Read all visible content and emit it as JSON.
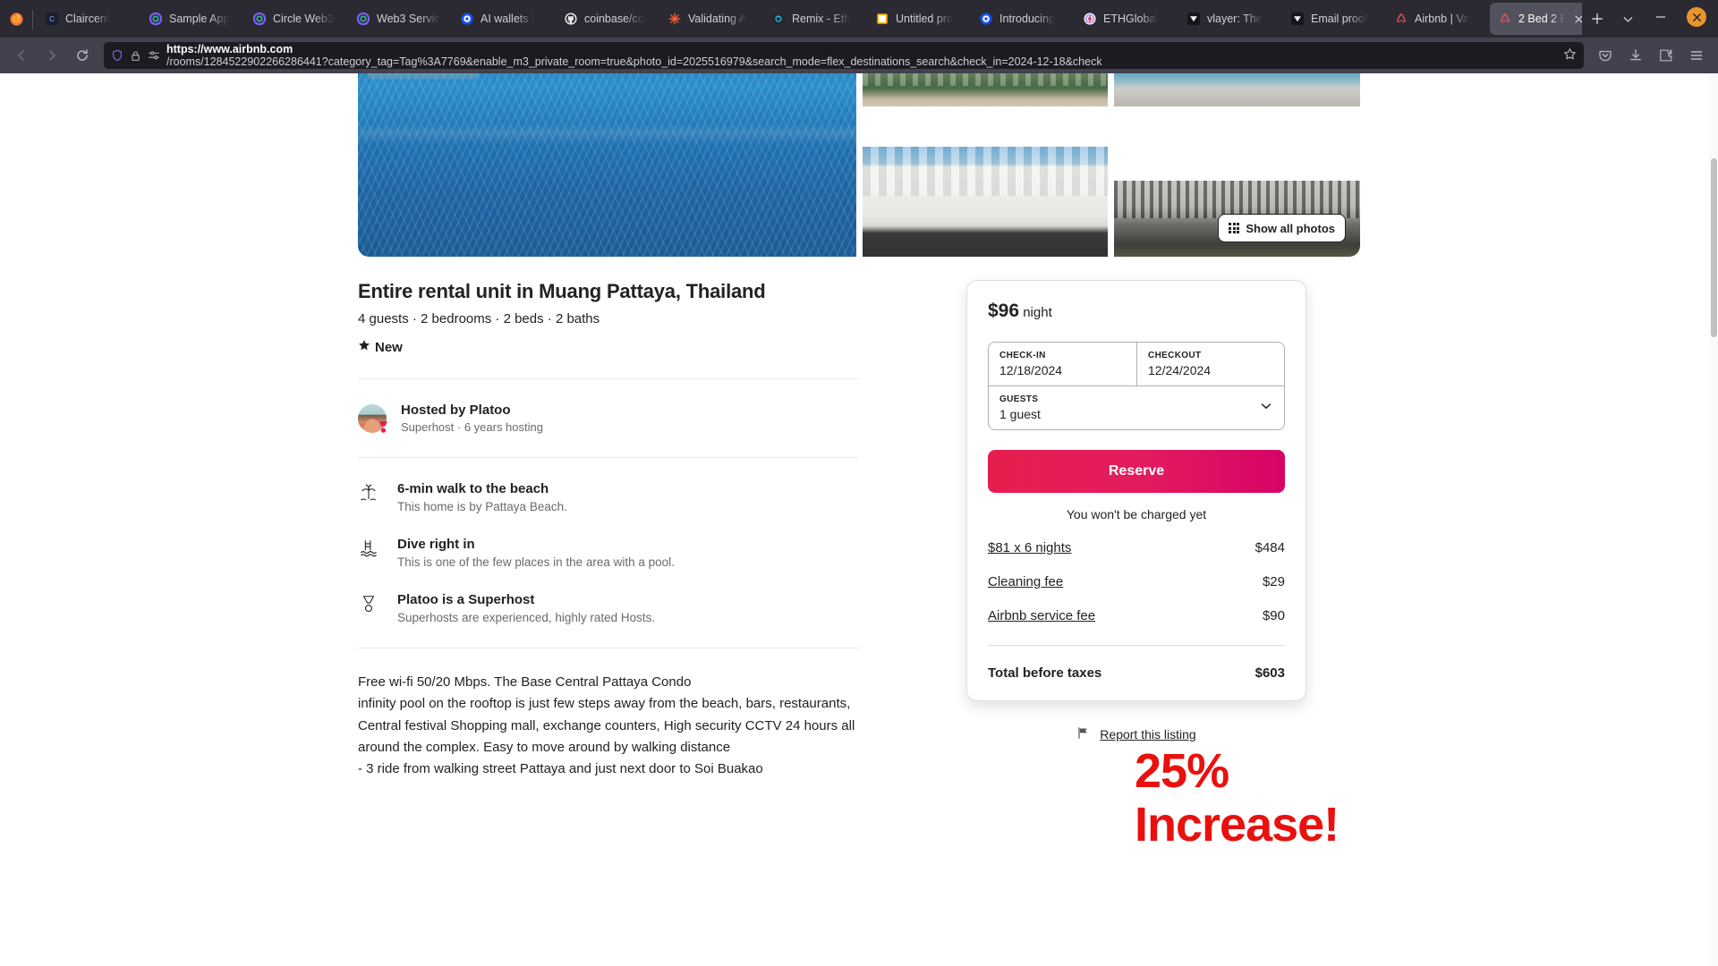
{
  "browser": {
    "tabs": [
      {
        "label": "Claircent",
        "icon": "claircent-favicon",
        "active": false
      },
      {
        "label": "Sample App",
        "icon": "circle-favicon",
        "active": false
      },
      {
        "label": "Circle Web3",
        "icon": "circle-favicon",
        "active": false
      },
      {
        "label": "Web3 Servic",
        "icon": "circle-favicon",
        "active": false
      },
      {
        "label": "AI wallets |",
        "icon": "coinbase-favicon",
        "active": false
      },
      {
        "label": "coinbase/co",
        "icon": "github-favicon",
        "active": false
      },
      {
        "label": "Validating A",
        "icon": "spark-favicon",
        "active": false
      },
      {
        "label": "Remix - Eth",
        "icon": "remix-favicon",
        "active": false
      },
      {
        "label": "Untitled pro",
        "icon": "note-favicon",
        "active": false
      },
      {
        "label": "Introducing",
        "icon": "coinbase-favicon",
        "active": false
      },
      {
        "label": "ETHGlobal",
        "icon": "ethglobal-favicon",
        "active": false
      },
      {
        "label": "vlayer: The",
        "icon": "vlayer-favicon",
        "active": false
      },
      {
        "label": "Email proof",
        "icon": "vlayer-favicon",
        "active": false
      },
      {
        "label": "Airbnb | Va",
        "icon": "airbnb-favicon",
        "active": false
      },
      {
        "label": "2 Bed 2 B",
        "icon": "airbnb-favicon",
        "active": true
      }
    ],
    "new_tab_label": "+",
    "list_all_tabs_label": "⌄",
    "minimize_label": "—",
    "close_label": "×",
    "nav": {
      "back": "back-arrow",
      "forward": "forward-arrow",
      "reload": "reload-arrow",
      "url_host": "https://www.airbnb.com",
      "url_path": "/rooms/1284522902266286441?category_tag=Tag%3A7769&enable_m3_private_room=true&photo_id=2025516979&search_mode=flex_destinations_search&check_in=2024-12-18&check",
      "bookmark": "star-icon",
      "save_to_pocket": "pocket-icon",
      "downloads": "download-icon",
      "extensions": "extensions-icon",
      "menu": "hamburger-icon"
    }
  },
  "gallery": {
    "show_all_label": "Show all photos",
    "images": [
      {
        "name": "rooftop-infinity-pool"
      },
      {
        "name": "terrace-garden"
      },
      {
        "name": "pool-deck-loungers"
      },
      {
        "name": "white-condo-building"
      },
      {
        "name": "condo-entrance-driveway"
      }
    ]
  },
  "listing": {
    "title": "Entire rental unit in Muang Pattaya, Thailand",
    "subinfo": "4 guests · 2 bedrooms · 2 beds · 2 baths",
    "rating": "New",
    "host": {
      "name": "Hosted by Platoo",
      "meta": "Superhost · 6 years hosting"
    },
    "features": [
      {
        "icon": "palm-tree-icon",
        "title": "6-min walk to the beach",
        "subtitle": "This home is by Pattaya Beach."
      },
      {
        "icon": "pool-icon",
        "title": "Dive right in",
        "subtitle": "This is one of the few places in the area with a pool."
      },
      {
        "icon": "superhost-medal-icon",
        "title": "Platoo is a Superhost",
        "subtitle": "Superhosts are experienced, highly rated Hosts."
      }
    ],
    "description": "Free wi-fi 50/20 Mbps. The Base Central Pattaya Condo\ninfinity pool on the rooftop  is just few steps away from the beach, bars, restaurants,\nCentral festival Shopping mall, exchange counters, High security CCTV 24 hours all\naround the complex. Easy to move around by walking distance\n- 3 ride from walking street Pattaya and just next door to Soi Buakao"
  },
  "booking": {
    "price_amount": "$96",
    "price_unit": "night",
    "checkin_label": "CHECK-IN",
    "checkin_value": "12/18/2024",
    "checkout_label": "CHECKOUT",
    "checkout_value": "12/24/2024",
    "guests_label": "GUESTS",
    "guests_value": "1 guest",
    "reserve_label": "Reserve",
    "no_charge_note": "You won't be charged yet",
    "fees": [
      {
        "label": "$81 x 6 nights",
        "value": "$484"
      },
      {
        "label": "Cleaning fee",
        "value": "$29"
      },
      {
        "label": "Airbnb service fee",
        "value": "$90"
      }
    ],
    "total_label": "Total before taxes",
    "total_value": "$603",
    "report_label": "Report this listing",
    "accent_color": "#e31c5f"
  },
  "annotation": {
    "line1": "25%",
    "line2": "Increase!",
    "color": "#e8110e"
  }
}
